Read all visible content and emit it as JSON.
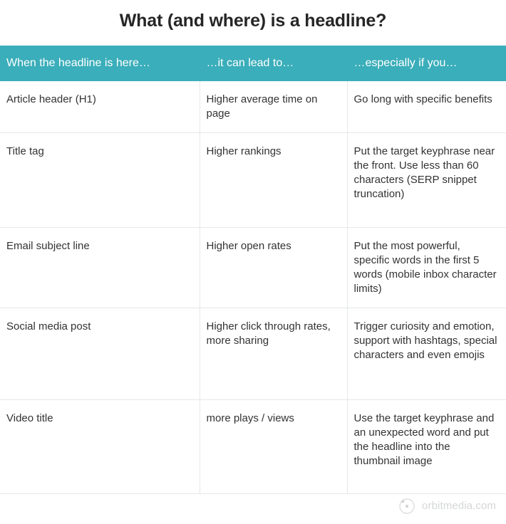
{
  "page_title": "What (and where) is a headline?",
  "table": {
    "columns": [
      "When the headline is here…",
      "…it can lead to…",
      "…especially if you…"
    ],
    "rows": [
      {
        "where": "Article header (H1)",
        "leads_to": "Higher average time on page",
        "especially": "Go long with specific benefits"
      },
      {
        "where": "Title tag",
        "leads_to": "Higher rankings",
        "especially": "Put the target keyphrase near the front. Use less than 60 characters (SERP snippet truncation)"
      },
      {
        "where": "Email subject line",
        "leads_to": "Higher open rates",
        "especially": "Put the most powerful, specific words in the first 5 words (mobile inbox character limits)"
      },
      {
        "where": "Social media post",
        "leads_to": "Higher click through rates, more sharing",
        "especially": "Trigger curiosity and emotion, support with hashtags, special characters and even emojis"
      },
      {
        "where": "Video title",
        "leads_to": "more plays / views",
        "especially": "Use the target keyphrase and an unexpected word and put the headline into the thumbnail image"
      }
    ]
  },
  "footer": {
    "brand_name": "orbitmedia.com",
    "brand_icon": "orbit-logo-icon"
  },
  "colors": {
    "header_teal": "#3AAEBA",
    "title_text": "#262626",
    "body_text": "#333333",
    "grid_line": "#e4e7e8",
    "footer_text": "#d4d6d7"
  }
}
